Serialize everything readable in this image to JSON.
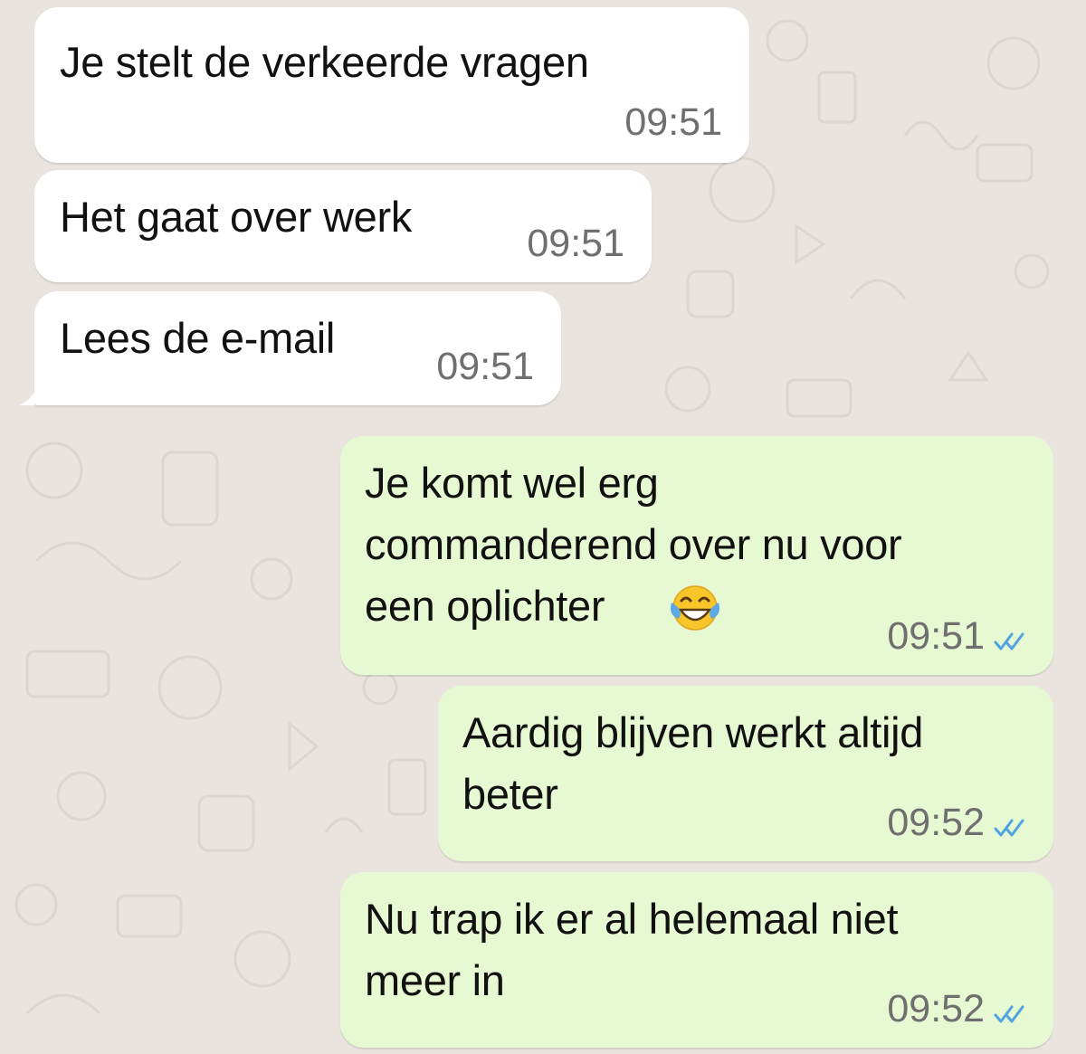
{
  "messages": [
    {
      "direction": "incoming",
      "text": "Je stelt de verkeerde vragen",
      "time": "09:51"
    },
    {
      "direction": "incoming",
      "text": "Het gaat over werk",
      "time": "09:51"
    },
    {
      "direction": "incoming",
      "text": "Lees de e-mail",
      "time": "09:51"
    },
    {
      "direction": "outgoing",
      "lines": [
        "Je komt wel erg",
        "commanderend over nu voor",
        "een oplichter"
      ],
      "emoji": "face-with-tears-of-joy",
      "time": "09:51",
      "status": "read"
    },
    {
      "direction": "outgoing",
      "lines": [
        "Aardig blijven werkt altijd",
        "beter"
      ],
      "time": "09:52",
      "status": "read"
    },
    {
      "direction": "outgoing",
      "lines": [
        "Nu trap ik er al helemaal niet",
        "meer in"
      ],
      "time": "09:52",
      "status": "read"
    }
  ],
  "colors": {
    "wallpaper": "#e9e5de",
    "incoming_bubble": "#ffffff",
    "outgoing_bubble": "#e7f9d3",
    "timestamp": "#6f6f6f",
    "read_ticks": "#4fa3e0"
  }
}
